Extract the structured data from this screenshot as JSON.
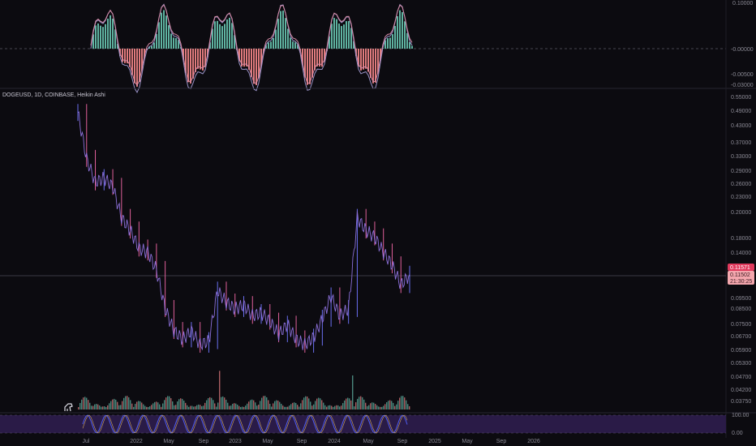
{
  "header": {
    "symbol_line": "DOGEUSD, 1D, COINBASE, Heikin Ashi"
  },
  "colors": {
    "bg": "#0c0b10",
    "up": "#5fb3a1",
    "down": "#e07b7d",
    "wick_blue": "#6a6ff0",
    "wick_pink": "#e0609a",
    "price_tag": "#e03a5d",
    "price_tag2": "#f0a0a8",
    "stoch_band": "#2a1b47",
    "stoch_line": "#4f5cf0"
  },
  "oscillator": {
    "ticks": [
      "0.10000",
      "-0.00000",
      "-0.00500",
      "-0.03000"
    ]
  },
  "price_axis": {
    "ticks": [
      "0.55000",
      "0.49000",
      "0.43000",
      "0.37000",
      "0.33000",
      "0.29000",
      "0.26000",
      "0.23000",
      "0.20000",
      "0.18000",
      "0.14000",
      "0.09500",
      "0.08500",
      "0.07500",
      "0.06700",
      "0.05900",
      "0.05300",
      "0.04700",
      "0.04200",
      "0.03750"
    ]
  },
  "price_tags": {
    "current": "0.11571",
    "second": "0.11502",
    "timer": "21:30:25"
  },
  "stoch_axis": {
    "ticks": [
      "100.00",
      "0.00"
    ]
  },
  "time_axis": {
    "labels": [
      "Jul",
      "2022",
      "May",
      "Sep",
      "2023",
      "May",
      "Sep",
      "2024",
      "May",
      "Sep",
      "2025",
      "May",
      "Sep",
      "2026"
    ]
  },
  "chart_data": {
    "type": "line",
    "title": "DOGEUSD, 1D, COINBASE, Heikin Ashi",
    "x": [
      "2021-07",
      "2021-08",
      "2021-09",
      "2021-10",
      "2021-11",
      "2021-12",
      "2022-01",
      "2022-02",
      "2022-03",
      "2022-04",
      "2022-05",
      "2022-06",
      "2022-07",
      "2022-08",
      "2022-09",
      "2022-10",
      "2022-11",
      "2022-12",
      "2023-01",
      "2023-02",
      "2023-03",
      "2023-04",
      "2023-05",
      "2023-06",
      "2023-07",
      "2023-08",
      "2023-09",
      "2023-10",
      "2023-11",
      "2023-12",
      "2024-01",
      "2024-02",
      "2024-03",
      "2024-04",
      "2024-05",
      "2024-06",
      "2024-07",
      "2024-08",
      "2024-09"
    ],
    "series": [
      {
        "values": [
          0.48,
          0.32,
          0.26,
          0.27,
          0.25,
          0.19,
          0.17,
          0.145,
          0.14,
          0.12,
          0.085,
          0.07,
          0.065,
          0.07,
          0.062,
          0.064,
          0.1,
          0.09,
          0.085,
          0.088,
          0.08,
          0.082,
          0.076,
          0.068,
          0.074,
          0.065,
          0.062,
          0.066,
          0.078,
          0.095,
          0.08,
          0.085,
          0.19,
          0.17,
          0.16,
          0.14,
          0.125,
          0.105,
          0.115
        ]
      }
    ],
    "xlim": [
      "2021-07",
      "2026-01"
    ],
    "ylim": [
      0.0375,
      0.55
    ]
  }
}
